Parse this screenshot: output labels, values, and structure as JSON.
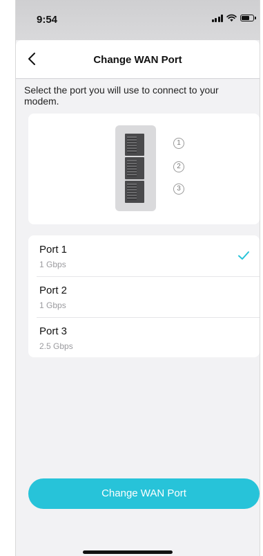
{
  "status_bar": {
    "time": "9:54",
    "icons": [
      "signal-icon",
      "wifi-icon",
      "battery-icon"
    ]
  },
  "nav": {
    "back_icon": "chevron-left-icon",
    "title": "Change WAN Port"
  },
  "description": "Select the port you will use to connect to your modem.",
  "diagram": {
    "port_numbers": [
      "1",
      "2",
      "3"
    ]
  },
  "ports": [
    {
      "name": "Port 1",
      "speed": "1 Gbps",
      "selected": true
    },
    {
      "name": "Port 2",
      "speed": "1 Gbps",
      "selected": false
    },
    {
      "name": "Port 3",
      "speed": "2.5 Gbps",
      "selected": false
    }
  ],
  "primary_button": {
    "label": "Change WAN Port"
  },
  "colors": {
    "accent": "#27c3d9",
    "background": "#f2f2f4",
    "card": "#ffffff"
  }
}
